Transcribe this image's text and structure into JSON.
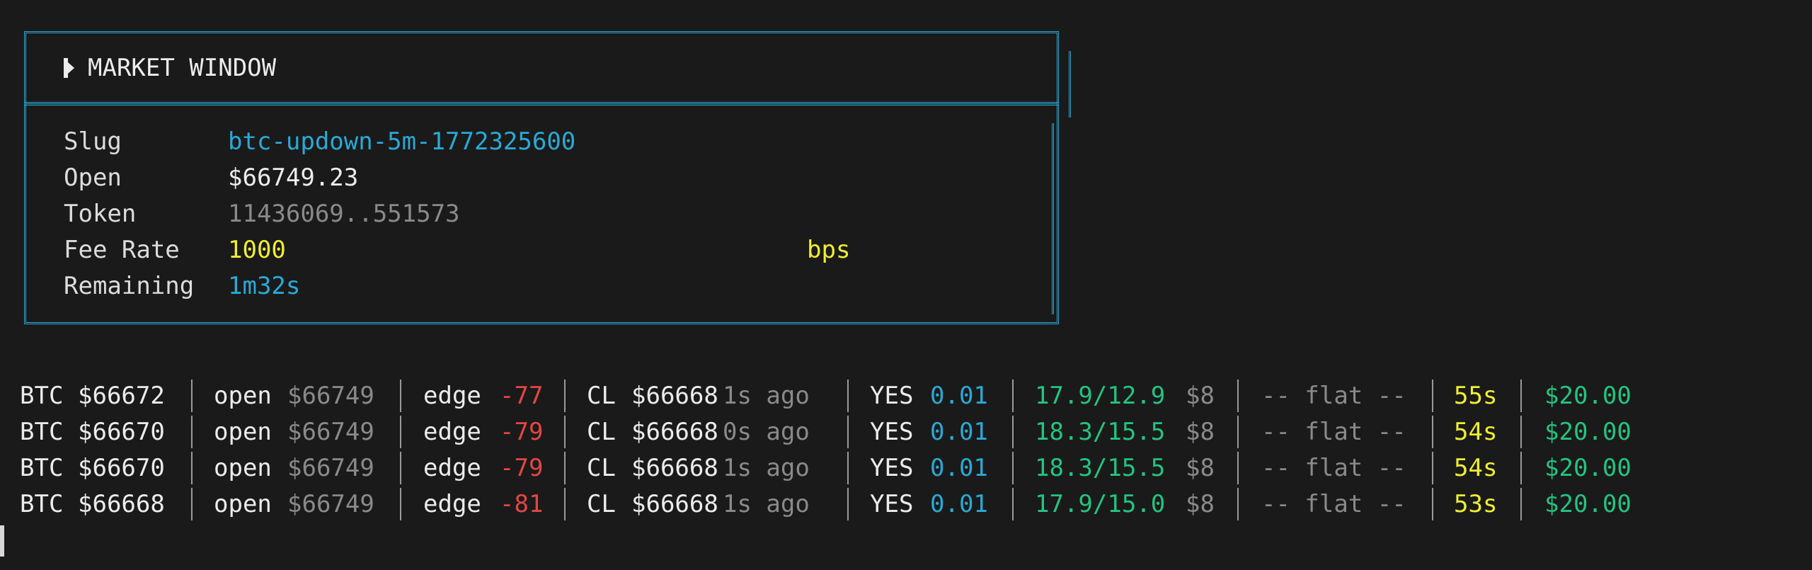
{
  "market_window": {
    "title": "MARKET WINDOW",
    "fields": [
      {
        "label": "Slug",
        "value": "btc-updown-5m-1772325600",
        "color": "cyan",
        "unit": ""
      },
      {
        "label": "Open",
        "value": "$66749.23",
        "color": "white",
        "unit": ""
      },
      {
        "label": "Token",
        "value": "11436069..551573",
        "color": "dim",
        "unit": ""
      },
      {
        "label": "Fee Rate",
        "value": "1000",
        "color": "yellow",
        "unit": "bps"
      },
      {
        "label": "Remaining",
        "value": "1m32s",
        "color": "cyan",
        "unit": ""
      }
    ]
  },
  "log_rows": [
    {
      "btc_label": "BTC",
      "btc_price": "$66672",
      "open_label": "open",
      "open_price": "$66749",
      "edge_label": "edge",
      "edge_value": "-77",
      "cl_label": "CL",
      "cl_price": "$66668",
      "cl_age": "1s ago",
      "side_label": "YES",
      "side_price": "0.01",
      "ratio": "17.9/12.9",
      "stake": "$8",
      "signal": "-- flat --",
      "countdown": "55s",
      "balance": "$20.00"
    },
    {
      "btc_label": "BTC",
      "btc_price": "$66670",
      "open_label": "open",
      "open_price": "$66749",
      "edge_label": "edge",
      "edge_value": "-79",
      "cl_label": "CL",
      "cl_price": "$66668",
      "cl_age": "0s ago",
      "side_label": "YES",
      "side_price": "0.01",
      "ratio": "18.3/15.5",
      "stake": "$8",
      "signal": "-- flat --",
      "countdown": "54s",
      "balance": "$20.00"
    },
    {
      "btc_label": "BTC",
      "btc_price": "$66670",
      "open_label": "open",
      "open_price": "$66749",
      "edge_label": "edge",
      "edge_value": "-79",
      "cl_label": "CL",
      "cl_price": "$66668",
      "cl_age": "1s ago",
      "side_label": "YES",
      "side_price": "0.01",
      "ratio": "18.3/15.5",
      "stake": "$8",
      "signal": "-- flat --",
      "countdown": "54s",
      "balance": "$20.00"
    },
    {
      "btc_label": "BTC",
      "btc_price": "$66668",
      "open_label": "open",
      "open_price": "$66749",
      "edge_label": "edge",
      "edge_value": "-81",
      "cl_label": "CL",
      "cl_price": "$66668",
      "cl_age": "1s ago",
      "side_label": "YES",
      "side_price": "0.01",
      "ratio": "17.9/15.0",
      "stake": "$8",
      "signal": "-- flat --",
      "countdown": "53s",
      "balance": "$20.00"
    }
  ],
  "colors": {
    "background": "#1a1a1a",
    "border": "#2aa9d6",
    "cyan": "#2aa9d6",
    "yellow": "#eeee33",
    "red": "#e54545",
    "green": "#23c47f",
    "dim": "#8a8a8a"
  }
}
